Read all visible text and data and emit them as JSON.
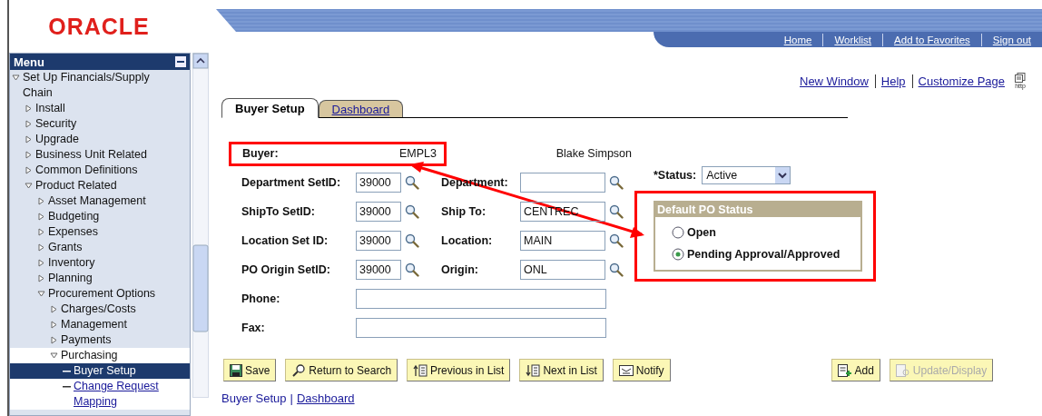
{
  "logo": {
    "text": "ORACLE"
  },
  "header_nav": [
    "Home",
    "Worklist",
    "Add to Favorites",
    "Sign out"
  ],
  "menu": {
    "title": "Menu",
    "items": [
      {
        "label": "Set Up Financials/Supply Chain",
        "kind": "folder",
        "expanded": true,
        "children": [
          {
            "label": "Install",
            "kind": "folder",
            "expanded": false
          },
          {
            "label": "Security",
            "kind": "folder",
            "expanded": false
          },
          {
            "label": "Upgrade",
            "kind": "folder",
            "expanded": false
          },
          {
            "label": "Business Unit Related",
            "kind": "folder",
            "expanded": false
          },
          {
            "label": "Common Definitions",
            "kind": "folder",
            "expanded": false
          },
          {
            "label": "Product Related",
            "kind": "folder",
            "expanded": true,
            "children": [
              {
                "label": "Asset Management",
                "kind": "folder",
                "expanded": false
              },
              {
                "label": "Budgeting",
                "kind": "folder",
                "expanded": false
              },
              {
                "label": "Expenses",
                "kind": "folder",
                "expanded": false
              },
              {
                "label": "Grants",
                "kind": "folder",
                "expanded": false
              },
              {
                "label": "Inventory",
                "kind": "folder",
                "expanded": false
              },
              {
                "label": "Planning",
                "kind": "folder",
                "expanded": false
              },
              {
                "label": "Procurement Options",
                "kind": "folder",
                "expanded": true,
                "children": [
                  {
                    "label": "Charges/Costs",
                    "kind": "folder",
                    "expanded": false
                  },
                  {
                    "label": "Management",
                    "kind": "folder",
                    "expanded": false
                  },
                  {
                    "label": "Payments",
                    "kind": "folder",
                    "expanded": false
                  },
                  {
                    "label": "Purchasing",
                    "kind": "folder",
                    "expanded": true,
                    "children": [
                      {
                        "label": "Buyer Setup",
                        "kind": "page",
                        "selected": true
                      },
                      {
                        "label": "Change Request Mapping",
                        "kind": "page",
                        "selected": false
                      }
                    ]
                  }
                ]
              }
            ]
          }
        ]
      }
    ]
  },
  "page_links": [
    "New Window",
    "Help",
    "Customize Page"
  ],
  "print_icon_label": "http",
  "tabs": [
    {
      "label": "Buyer Setup",
      "selected": true
    },
    {
      "label": "Dashboard",
      "selected": false
    }
  ],
  "buyer": {
    "label": "Buyer:",
    "value": "EMPL3",
    "name": "Blake Simpson"
  },
  "fields": [
    {
      "label": "Department SetID:",
      "value": "39000",
      "label2": "Department:"
    },
    {
      "label": "ShipTo SetID:",
      "value": "39000",
      "label2": "Ship To:",
      "value2": "CENTREC"
    },
    {
      "label": "Location Set ID:",
      "value": "39000",
      "label2": "Location:",
      "value2": "MAIN"
    },
    {
      "label": "PO Origin SetID:",
      "value": "39000",
      "label2": "Origin:",
      "value2": "ONL"
    }
  ],
  "wide_fields": [
    {
      "label": "Phone:"
    },
    {
      "label": "Fax:"
    }
  ],
  "status": {
    "label": "*Status:",
    "value": "Active"
  },
  "default_po_status": {
    "title": "Default PO Status",
    "options": [
      {
        "label": "Open",
        "selected": false
      },
      {
        "label": "Pending Approval/Approved",
        "selected": true
      }
    ]
  },
  "buttons": [
    {
      "label": "Save",
      "kind": "save",
      "disabled": false
    },
    {
      "label": "Return to Search",
      "kind": "search",
      "disabled": false
    },
    {
      "label": "Previous in List",
      "kind": "previous",
      "disabled": false
    },
    {
      "label": "Next in List",
      "kind": "next",
      "disabled": false
    },
    {
      "label": "Notify",
      "kind": "notify",
      "disabled": false
    }
  ],
  "right_buttons": [
    {
      "label": "Add",
      "kind": "add",
      "disabled": false
    },
    {
      "label": "Update/Display",
      "kind": "update",
      "disabled": true
    }
  ],
  "bottom_links_separator": "|",
  "bottom_links": [
    {
      "label": "Buyer Setup",
      "selected": true
    },
    {
      "label": "Dashboard",
      "selected": false
    }
  ]
}
